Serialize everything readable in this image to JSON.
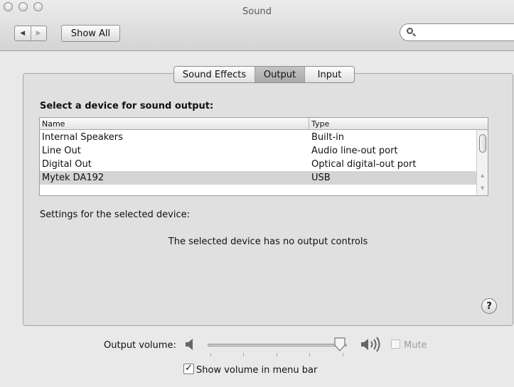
{
  "window": {
    "title": "Sound",
    "nav": {
      "back": "◀",
      "forward": "▶"
    },
    "show_all_label": "Show All",
    "search": {
      "value": "",
      "placeholder": ""
    }
  },
  "tabs": [
    {
      "label": "Sound Effects",
      "selected": false
    },
    {
      "label": "Output",
      "selected": true
    },
    {
      "label": "Input",
      "selected": false
    }
  ],
  "output": {
    "heading": "Select a device for sound output:",
    "columns": {
      "name": "Name",
      "type": "Type"
    },
    "devices": [
      {
        "name": "Internal Speakers",
        "type": "Built-in"
      },
      {
        "name": "Line Out",
        "type": "Audio line-out port"
      },
      {
        "name": "Digital Out",
        "type": "Optical digital-out port"
      },
      {
        "name": "Mytek  DA192",
        "type": "USB"
      }
    ],
    "selected_device_index": 3,
    "settings_label": "Settings for the selected device:",
    "no_controls_message": "The selected device has no output controls",
    "help_label": "?"
  },
  "volume": {
    "label": "Output volume:",
    "level": 0.95,
    "mute_label": "Mute",
    "mute_checked": false,
    "mute_enabled": false
  },
  "menu_bar": {
    "label": "Show volume in menu bar",
    "checked": true,
    "check_glyph": "✓"
  }
}
